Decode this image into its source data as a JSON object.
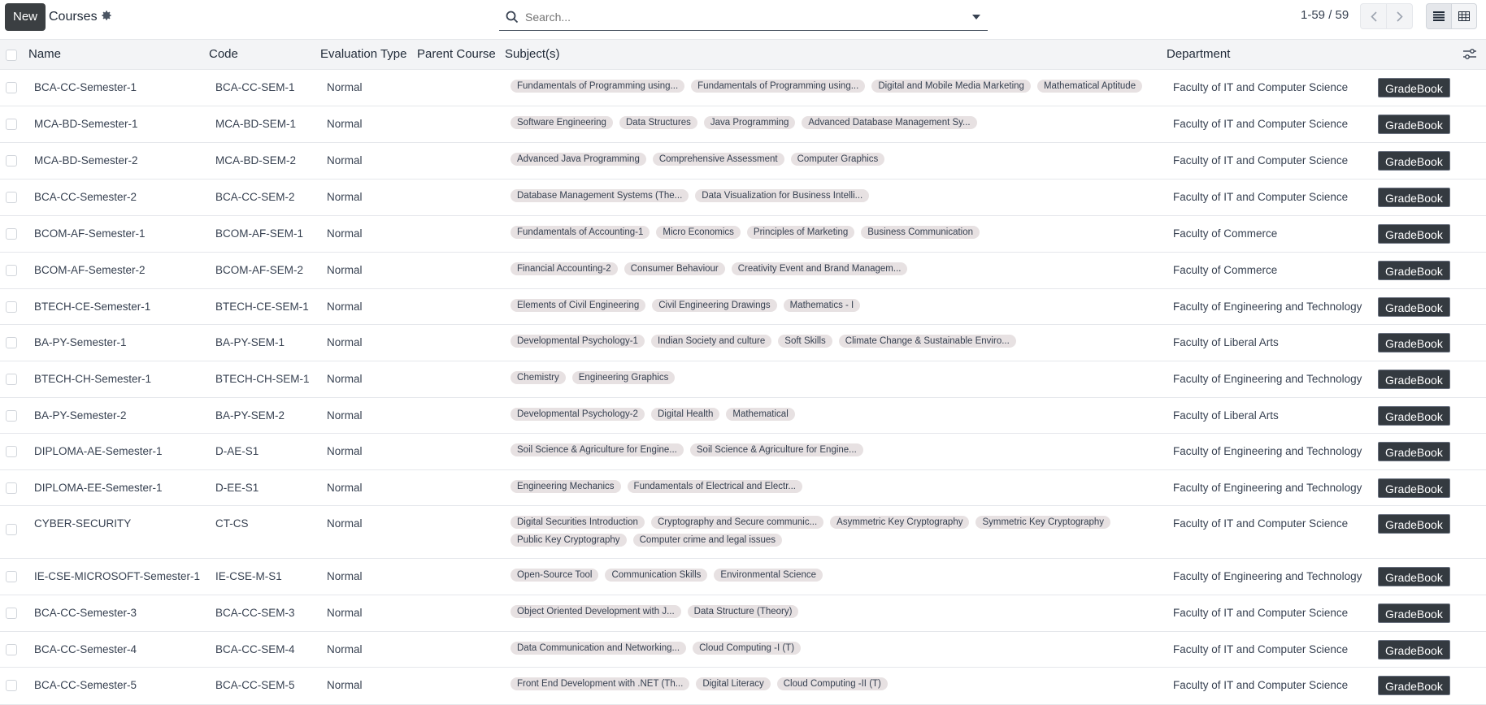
{
  "toolbar": {
    "new_label": "New",
    "breadcrumb": "Courses",
    "settings_icon": "gear-icon"
  },
  "search": {
    "placeholder": "Search..."
  },
  "pager": {
    "text": "1-59 / 59"
  },
  "columns": {
    "name": "Name",
    "code": "Code",
    "evaluation_type": "Evaluation Type",
    "parent_course": "Parent Course",
    "subjects": "Subject(s)",
    "department": "Department"
  },
  "gradebook_label": "GradeBook",
  "rows": [
    {
      "name": "BCA-CC-Semester-1",
      "code": "BCA-CC-SEM-1",
      "evaluation": "Normal",
      "subjects": [
        "Fundamentals of Programming using...",
        "Fundamentals of Programming using...",
        "Digital and Mobile Media Marketing",
        "Mathematical Aptitude"
      ],
      "department": "Faculty of IT and Computer Science"
    },
    {
      "name": "MCA-BD-Semester-1",
      "code": "MCA-BD-SEM-1",
      "evaluation": "Normal",
      "subjects": [
        "Software Engineering",
        "Data Structures",
        "Java Programming",
        "Advanced Database Management Sy..."
      ],
      "department": "Faculty of IT and Computer Science"
    },
    {
      "name": "MCA-BD-Semester-2",
      "code": "MCA-BD-SEM-2",
      "evaluation": "Normal",
      "subjects": [
        "Advanced Java Programming",
        "Comprehensive Assessment",
        "Computer Graphics"
      ],
      "department": "Faculty of IT and Computer Science"
    },
    {
      "name": "BCA-CC-Semester-2",
      "code": "BCA-CC-SEM-2",
      "evaluation": "Normal",
      "subjects": [
        "Database Management Systems (The...",
        "Data Visualization for Business Intelli..."
      ],
      "department": "Faculty of IT and Computer Science"
    },
    {
      "name": "BCOM-AF-Semester-1",
      "code": "BCOM-AF-SEM-1",
      "evaluation": "Normal",
      "subjects": [
        "Fundamentals of Accounting-1",
        "Micro Economics",
        "Principles of Marketing",
        "Business Communication"
      ],
      "department": "Faculty of Commerce"
    },
    {
      "name": "BCOM-AF-Semester-2",
      "code": "BCOM-AF-SEM-2",
      "evaluation": "Normal",
      "subjects": [
        "Financial Accounting-2",
        "Consumer Behaviour",
        "Creativity Event and Brand Managem..."
      ],
      "department": "Faculty of Commerce"
    },
    {
      "name": "BTECH-CE-Semester-1",
      "code": "BTECH-CE-SEM-1",
      "evaluation": "Normal",
      "subjects": [
        "Elements of Civil Engineering",
        "Civil Engineering Drawings",
        "Mathematics - I"
      ],
      "department": "Faculty of Engineering and Technology"
    },
    {
      "name": "BA-PY-Semester-1",
      "code": "BA-PY-SEM-1",
      "evaluation": "Normal",
      "subjects": [
        "Developmental Psychology-1",
        "Indian Society and culture",
        "Soft Skills",
        "Climate Change & Sustainable Enviro..."
      ],
      "department": "Faculty of Liberal Arts"
    },
    {
      "name": "BTECH-CH-Semester-1",
      "code": "BTECH-CH-SEM-1",
      "evaluation": "Normal",
      "subjects": [
        "Chemistry",
        "Engineering Graphics"
      ],
      "department": "Faculty of Engineering and Technology"
    },
    {
      "name": "BA-PY-Semester-2",
      "code": "BA-PY-SEM-2",
      "evaluation": "Normal",
      "subjects": [
        "Developmental Psychology-2",
        "Digital Health",
        "Mathematical"
      ],
      "department": "Faculty of Liberal Arts"
    },
    {
      "name": "DIPLOMA-AE-Semester-1",
      "code": "D-AE-S1",
      "evaluation": "Normal",
      "subjects": [
        "Soil Science & Agriculture for Engine...",
        "Soil Science & Agriculture for Engine..."
      ],
      "department": "Faculty of Engineering and Technology"
    },
    {
      "name": "DIPLOMA-EE-Semester-1",
      "code": "D-EE-S1",
      "evaluation": "Normal",
      "subjects": [
        "Engineering Mechanics",
        "Fundamentals of Electrical and Electr..."
      ],
      "department": "Faculty of Engineering and Technology"
    },
    {
      "name": "CYBER-SECURITY",
      "code": "CT-CS",
      "evaluation": "Normal",
      "subjects": [
        "Digital Securities Introduction",
        "Cryptography and Secure communic...",
        "Asymmetric Key Cryptography",
        "Symmetric Key Cryptography",
        "Public Key Cryptography",
        "Computer crime and legal issues"
      ],
      "department": "Faculty of IT and Computer Science"
    },
    {
      "name": "IE-CSE-MICROSOFT-Semester-1",
      "code": "IE-CSE-M-S1",
      "evaluation": "Normal",
      "subjects": [
        "Open-Source Tool",
        "Communication Skills",
        "Environmental Science"
      ],
      "department": "Faculty of Engineering and Technology"
    },
    {
      "name": "BCA-CC-Semester-3",
      "code": "BCA-CC-SEM-3",
      "evaluation": "Normal",
      "subjects": [
        "Object Oriented Development with J...",
        "Data Structure (Theory)"
      ],
      "department": "Faculty of IT and Computer Science"
    },
    {
      "name": "BCA-CC-Semester-4",
      "code": "BCA-CC-SEM-4",
      "evaluation": "Normal",
      "subjects": [
        "Data Communication and Networking...",
        "Cloud Computing -I (T)"
      ],
      "department": "Faculty of IT and Computer Science"
    },
    {
      "name": "BCA-CC-Semester-5",
      "code": "BCA-CC-SEM-5",
      "evaluation": "Normal",
      "subjects": [
        "Front End Development with .NET (Th...",
        "Digital Literacy",
        "Cloud Computing -II (T)"
      ],
      "department": "Faculty of IT and Computer Science"
    }
  ]
}
